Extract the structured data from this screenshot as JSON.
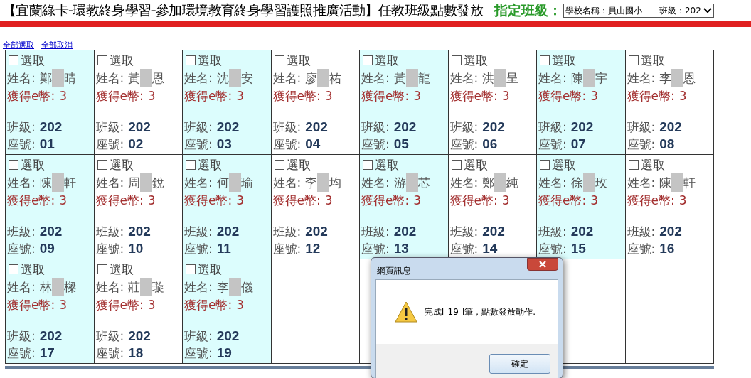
{
  "header": {
    "title": "【宜蘭綠卡-環教終身學習-參加環境教育終身學習護照推廣活動】任教班級點數發放",
    "class_label": "指定班級：",
    "class_select": "學校名稱：員山國小　　班級：202"
  },
  "links": [
    "全部選取",
    "全部取消"
  ],
  "students": [
    {
      "check_label": "選取",
      "checked": false,
      "name_label": "姓名:",
      "name_first": "鄭",
      "name_last": "晴",
      "coins_label": "獲得e幣:",
      "coins": "3",
      "class_label": "班級:",
      "class": "202",
      "seat_label": "座號:",
      "seat": "01"
    },
    {
      "check_label": "選取",
      "checked": false,
      "name_label": "姓名:",
      "name_first": "黃",
      "name_last": "恩",
      "coins_label": "獲得e幣:",
      "coins": "3",
      "class_label": "班級:",
      "class": "202",
      "seat_label": "座號:",
      "seat": "02"
    },
    {
      "check_label": "選取",
      "checked": false,
      "name_label": "姓名:",
      "name_first": "沈",
      "name_last": "安",
      "coins_label": "獲得e幣:",
      "coins": "3",
      "class_label": "班級:",
      "class": "202",
      "seat_label": "座號:",
      "seat": "03"
    },
    {
      "check_label": "選取",
      "checked": false,
      "name_label": "姓名:",
      "name_first": "廖",
      "name_last": "祐",
      "coins_label": "獲得e幣:",
      "coins": "3",
      "class_label": "班級:",
      "class": "202",
      "seat_label": "座號:",
      "seat": "04"
    },
    {
      "check_label": "選取",
      "checked": false,
      "name_label": "姓名:",
      "name_first": "黃",
      "name_last": "龍",
      "coins_label": "獲得e幣:",
      "coins": "3",
      "class_label": "班級:",
      "class": "202",
      "seat_label": "座號:",
      "seat": "05"
    },
    {
      "check_label": "選取",
      "checked": false,
      "name_label": "姓名:",
      "name_first": "洪",
      "name_last": "呈",
      "coins_label": "獲得e幣:",
      "coins": "3",
      "class_label": "班級:",
      "class": "202",
      "seat_label": "座號:",
      "seat": "06"
    },
    {
      "check_label": "選取",
      "checked": false,
      "name_label": "姓名:",
      "name_first": "陳",
      "name_last": "宇",
      "coins_label": "獲得e幣:",
      "coins": "3",
      "class_label": "班級:",
      "class": "202",
      "seat_label": "座號:",
      "seat": "07"
    },
    {
      "check_label": "選取",
      "checked": false,
      "name_label": "姓名:",
      "name_first": "李",
      "name_last": "恩",
      "coins_label": "獲得e幣:",
      "coins": "3",
      "class_label": "班級:",
      "class": "202",
      "seat_label": "座號:",
      "seat": "08"
    },
    {
      "check_label": "選取",
      "checked": false,
      "name_label": "姓名:",
      "name_first": "陳",
      "name_last": "軒",
      "coins_label": "獲得e幣:",
      "coins": "3",
      "class_label": "班級:",
      "class": "202",
      "seat_label": "座號:",
      "seat": "09"
    },
    {
      "check_label": "選取",
      "checked": false,
      "name_label": "姓名:",
      "name_first": "周",
      "name_last": "銳",
      "coins_label": "獲得e幣:",
      "coins": "3",
      "class_label": "班級:",
      "class": "202",
      "seat_label": "座號:",
      "seat": "10"
    },
    {
      "check_label": "選取",
      "checked": false,
      "name_label": "姓名:",
      "name_first": "何",
      "name_last": "瑜",
      "coins_label": "獲得e幣:",
      "coins": "3",
      "class_label": "班級:",
      "class": "202",
      "seat_label": "座號:",
      "seat": "11"
    },
    {
      "check_label": "選取",
      "checked": false,
      "name_label": "姓名:",
      "name_first": "李",
      "name_last": "均",
      "coins_label": "獲得e幣:",
      "coins": "3",
      "class_label": "班級:",
      "class": "202",
      "seat_label": "座號:",
      "seat": "12"
    },
    {
      "check_label": "選取",
      "checked": false,
      "name_label": "姓名:",
      "name_first": "游",
      "name_last": "芯",
      "coins_label": "獲得e幣:",
      "coins": "3",
      "class_label": "班級:",
      "class": "202",
      "seat_label": "座號:",
      "seat": "13"
    },
    {
      "check_label": "選取",
      "checked": false,
      "name_label": "姓名:",
      "name_first": "鄭",
      "name_last": "純",
      "coins_label": "獲得e幣:",
      "coins": "3",
      "class_label": "班級:",
      "class": "202",
      "seat_label": "座號:",
      "seat": "14"
    },
    {
      "check_label": "選取",
      "checked": false,
      "name_label": "姓名:",
      "name_first": "徐",
      "name_last": "玫",
      "coins_label": "獲得e幣:",
      "coins": "3",
      "class_label": "班級:",
      "class": "202",
      "seat_label": "座號:",
      "seat": "15"
    },
    {
      "check_label": "選取",
      "checked": false,
      "name_label": "姓名:",
      "name_first": "陳",
      "name_last": "軒",
      "coins_label": "獲得e幣:",
      "coins": "3",
      "class_label": "班級:",
      "class": "202",
      "seat_label": "座號:",
      "seat": "16"
    },
    {
      "check_label": "選取",
      "checked": false,
      "name_label": "姓名:",
      "name_first": "林",
      "name_last": "樑",
      "coins_label": "獲得e幣:",
      "coins": "3",
      "class_label": "班級:",
      "class": "202",
      "seat_label": "座號:",
      "seat": "17"
    },
    {
      "check_label": "選取",
      "checked": false,
      "name_label": "姓名:",
      "name_first": "莊",
      "name_last": "璇",
      "coins_label": "獲得e幣:",
      "coins": "3",
      "class_label": "班級:",
      "class": "202",
      "seat_label": "座號:",
      "seat": "18"
    },
    {
      "check_label": "選取",
      "checked": false,
      "name_label": "姓名:",
      "name_first": "李",
      "name_last": "儀",
      "coins_label": "獲得e幣:",
      "coins": "3",
      "class_label": "班級:",
      "class": "202",
      "seat_label": "座號:",
      "seat": "19"
    }
  ],
  "dialog": {
    "title": "網頁訊息",
    "message": "完成[ 19 ]筆，點數發放動作.",
    "ok_button": "確定"
  }
}
